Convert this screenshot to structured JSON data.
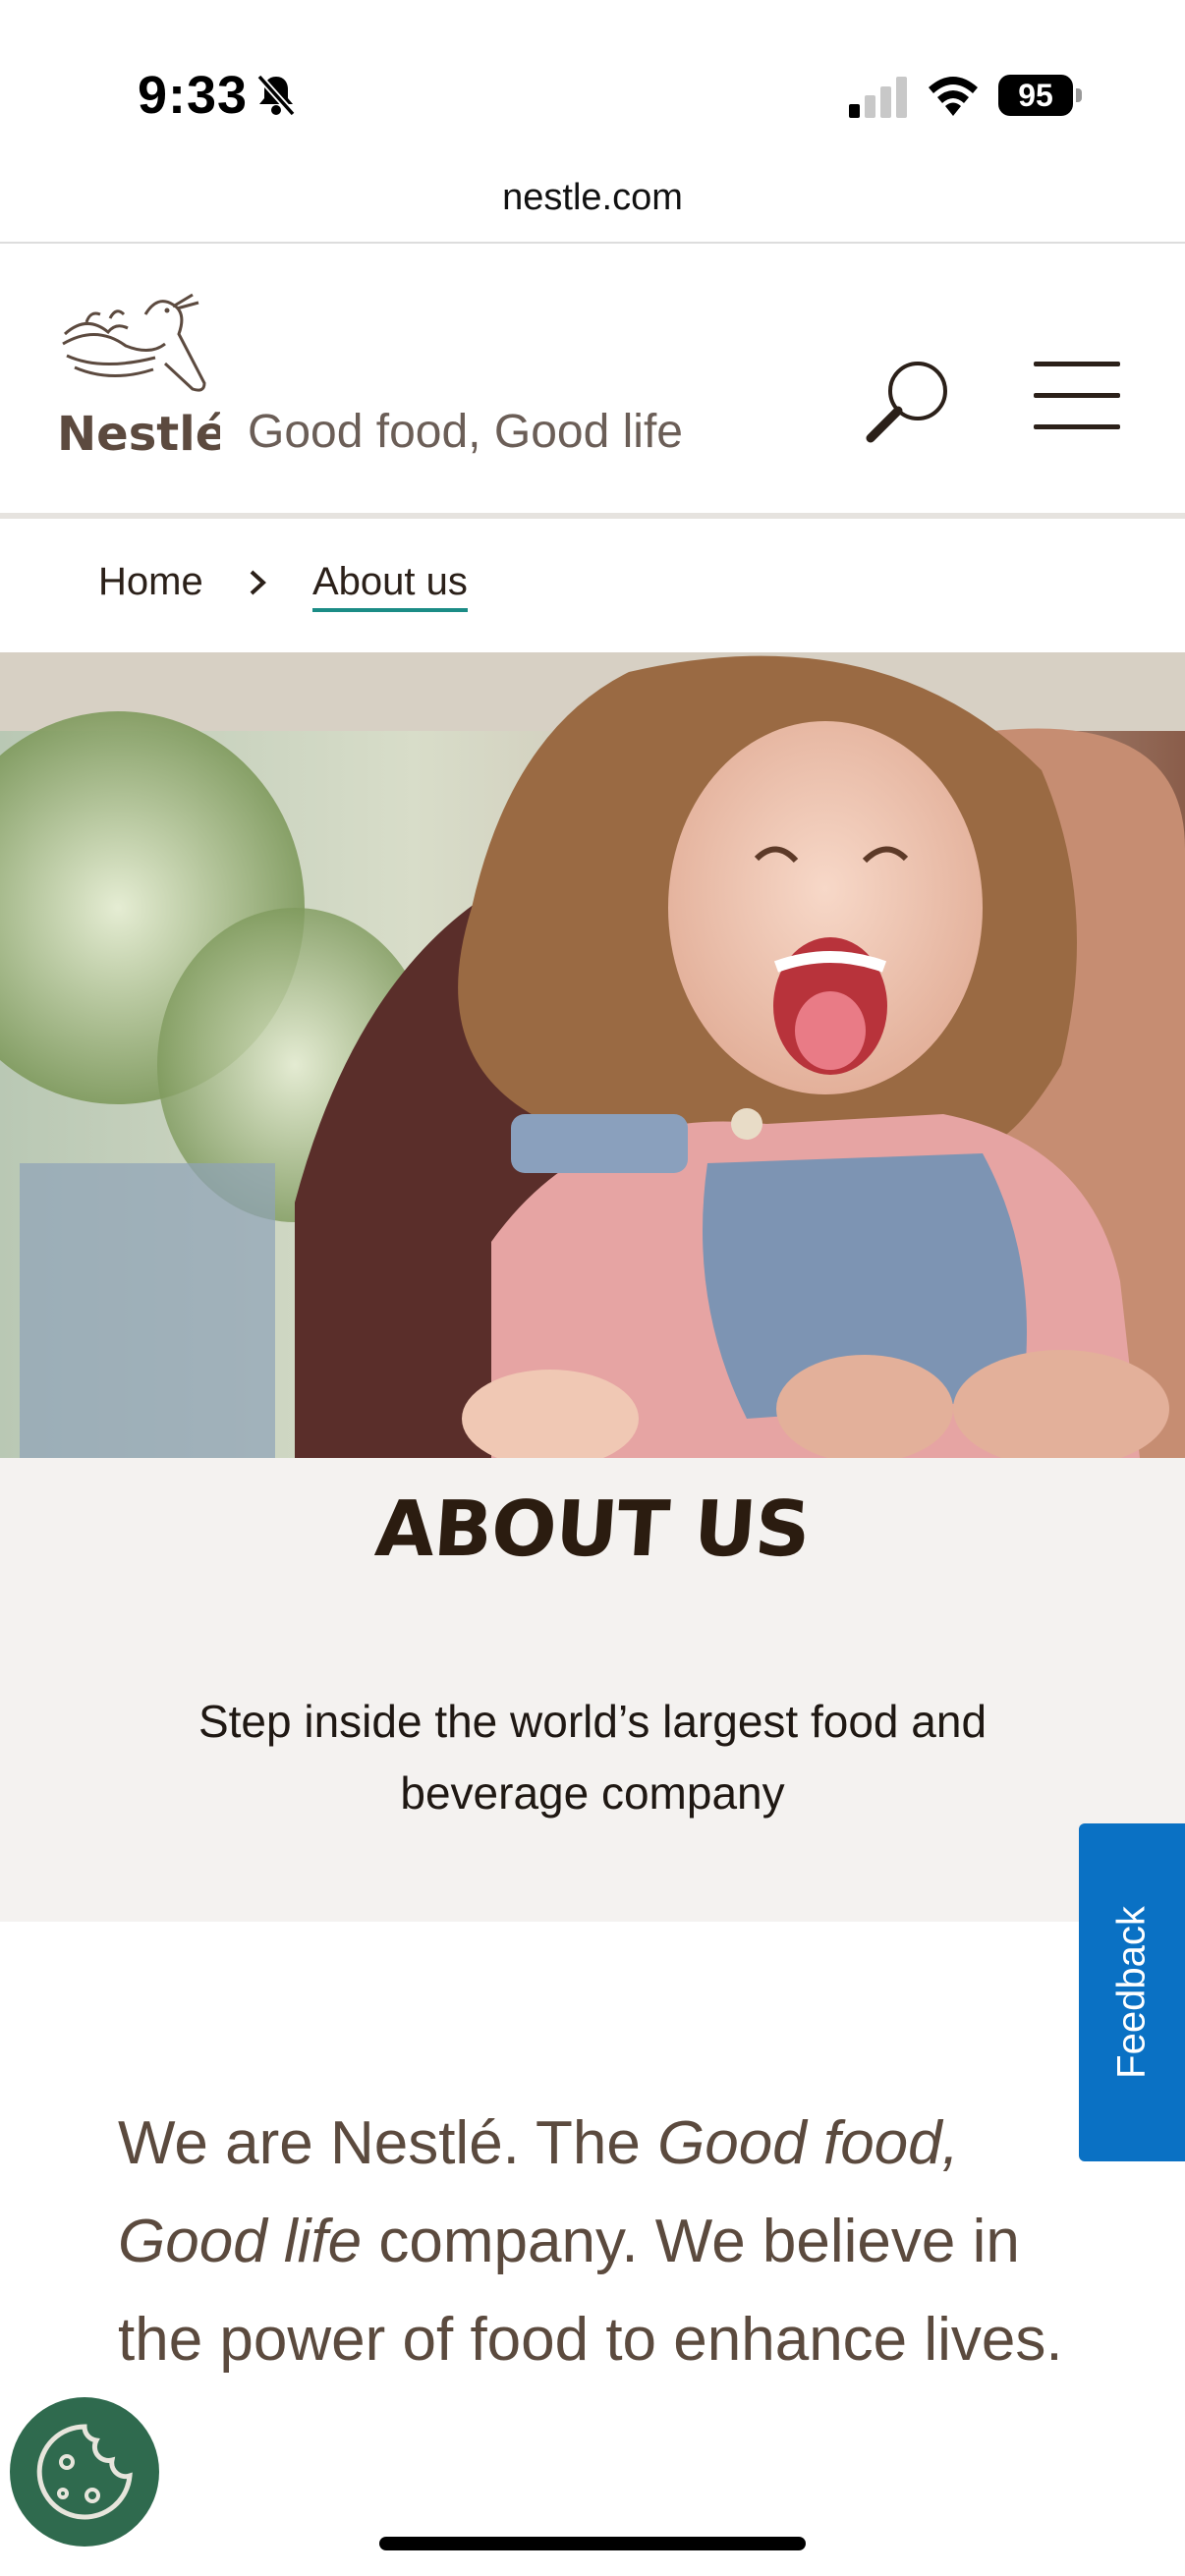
{
  "status_bar": {
    "time": "9:33",
    "battery": "95",
    "icons": [
      "bell-slash-icon",
      "signal-icon",
      "wifi-icon",
      "battery-icon"
    ]
  },
  "browser": {
    "url": "nestle.com"
  },
  "header": {
    "logo_text": "Nestlé",
    "tagline": "Good food, Good life",
    "search_icon": "search-icon",
    "menu_icon": "hamburger-menu-icon"
  },
  "breadcrumb": {
    "home": "Home",
    "current": "About us",
    "separator_icon": "chevron-right-icon"
  },
  "about": {
    "title": "ABOUT US",
    "subtitle": "Step inside the world’s largest food and beverage company"
  },
  "intro": {
    "part1": "We are Nestlé. The ",
    "emphasis": "Good food, Good life",
    "part2": " company. We believe in the power of food to enhance lives."
  },
  "feedback": {
    "label": "Feedback"
  },
  "cookie": {
    "icon": "cookie-icon"
  },
  "colors": {
    "brand_brown": "#2b2019",
    "breadcrumb_underline": "#1b8c86",
    "feedback_blue": "#0a71c4",
    "cookie_green": "#2f6a4e",
    "band_bg": "#f4f2f0"
  }
}
